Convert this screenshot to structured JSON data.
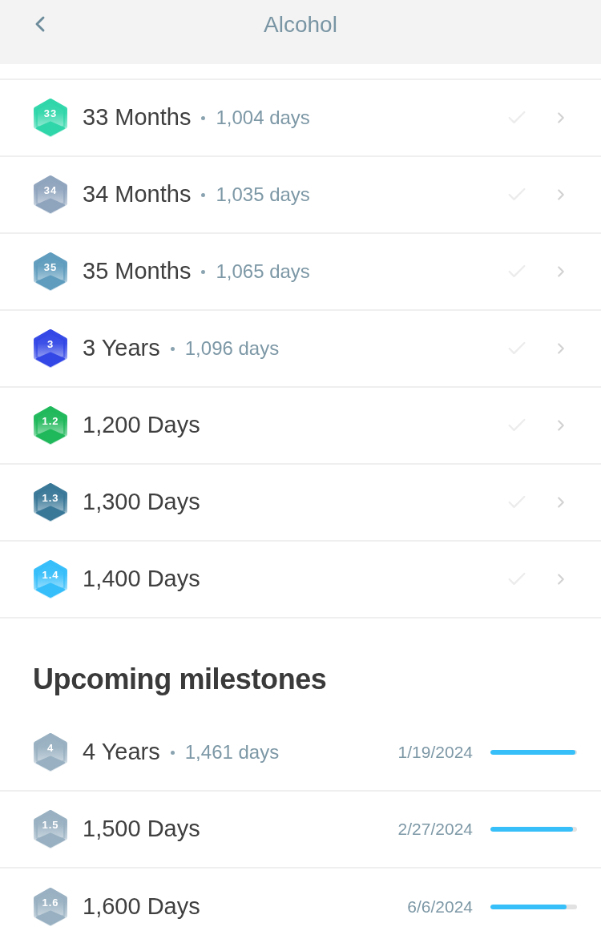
{
  "header": {
    "title": "Alcohol"
  },
  "milestones": [
    {
      "badge": "33",
      "color": "#2fd6a9",
      "title": "33 Months",
      "days": "1,004 days",
      "checked": false
    },
    {
      "badge": "34",
      "color": "#8fa4bd",
      "title": "34 Months",
      "days": "1,035 days",
      "checked": false
    },
    {
      "badge": "35",
      "color": "#5f9cbd",
      "title": "35 Months",
      "days": "1,065 days",
      "checked": false
    },
    {
      "badge": "3",
      "color": "#3347e6",
      "title": "3 Years",
      "days": "1,096 days",
      "checked": false
    },
    {
      "badge": "1.2",
      "color": "#1fb85a",
      "title": "1,200 Days",
      "checked": false
    },
    {
      "badge": "1.3",
      "color": "#3a7898",
      "title": "1,300 Days",
      "checked": false
    },
    {
      "badge": "1.4",
      "color": "#36befa",
      "title": "1,400 Days",
      "checked": false
    }
  ],
  "upcoming": {
    "title": "Upcoming milestones",
    "items": [
      {
        "badge": "4",
        "color": "#98b0c1",
        "title": "4 Years",
        "days": "1,461 days",
        "date": "1/19/2024",
        "level": 1
      },
      {
        "badge": "1.5",
        "color": "#98b0c1",
        "title": "1,500 Days",
        "date": "2/27/2024",
        "level": 0.97
      },
      {
        "badge": "1.6",
        "color": "#98b0c1",
        "title": "1,600 Days",
        "date": "6/6/2024",
        "level": 0.9
      }
    ]
  }
}
